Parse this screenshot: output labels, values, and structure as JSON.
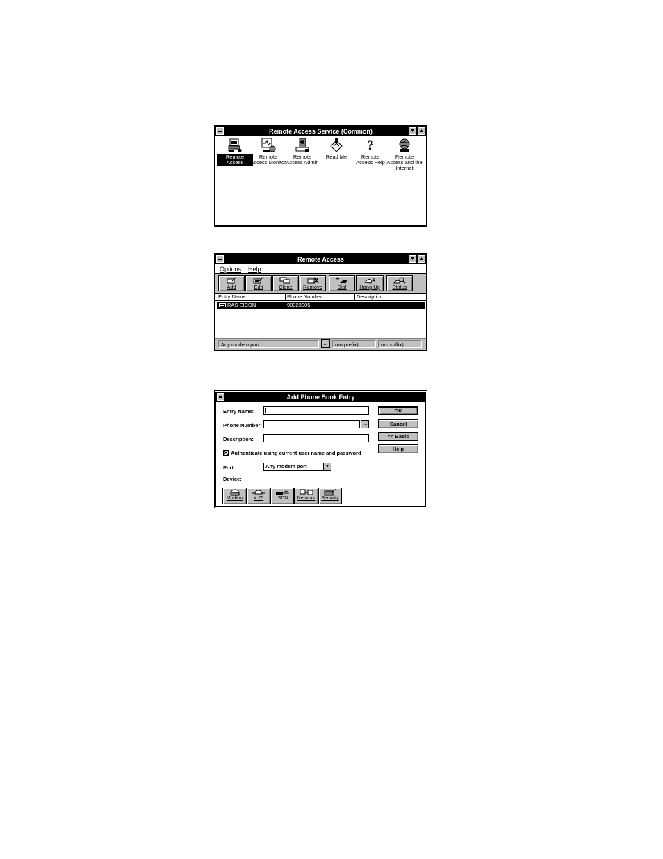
{
  "window1": {
    "title": "Remote Access Service (Common)",
    "icons": [
      {
        "label": "Remote Access",
        "icon": "computer-phone-icon",
        "selected": true
      },
      {
        "label": "Remote Access Monitor",
        "icon": "monitor-icon"
      },
      {
        "label": "Remote Access Admin",
        "icon": "admin-icon"
      },
      {
        "label": "Read Me",
        "icon": "readme-icon"
      },
      {
        "label": "Remote Access Help",
        "icon": "help-question-icon"
      },
      {
        "label": "Remote Access and the Internet",
        "icon": "globe-icon"
      }
    ]
  },
  "window2": {
    "title": "Remote Access",
    "menu": [
      "Options",
      "Help"
    ],
    "toolbar": [
      "Add",
      "Edit",
      "Clone",
      "Remove",
      "Dial",
      "Hang Up",
      "Status"
    ],
    "columns": [
      "Entry Name",
      "Phone Number",
      "Description"
    ],
    "rows": [
      {
        "name": "RAS EICON",
        "phone": "98323005",
        "description": ""
      }
    ],
    "status": {
      "port": "Any modem port",
      "browse": "...",
      "prefix": "(no prefix)",
      "suffix": "(no suffix)"
    }
  },
  "dialog": {
    "title": "Add Phone Book Entry",
    "entry_name_label": "Entry Name:",
    "phone_number_label": "Phone Number:",
    "description_label": "Description:",
    "browse_label": "...",
    "auth_checkbox_label": "Authenticate using current user name and password",
    "auth_checked": true,
    "port_label": "Port:",
    "port_value": "Any modem port",
    "device_label": "Device:",
    "buttons": {
      "ok": "OK",
      "cancel": "Cancel",
      "basic": "<< Basic",
      "help": "Help"
    },
    "tabs": [
      "Modem",
      "X.25",
      "ISDN",
      "Network",
      "Security"
    ]
  }
}
